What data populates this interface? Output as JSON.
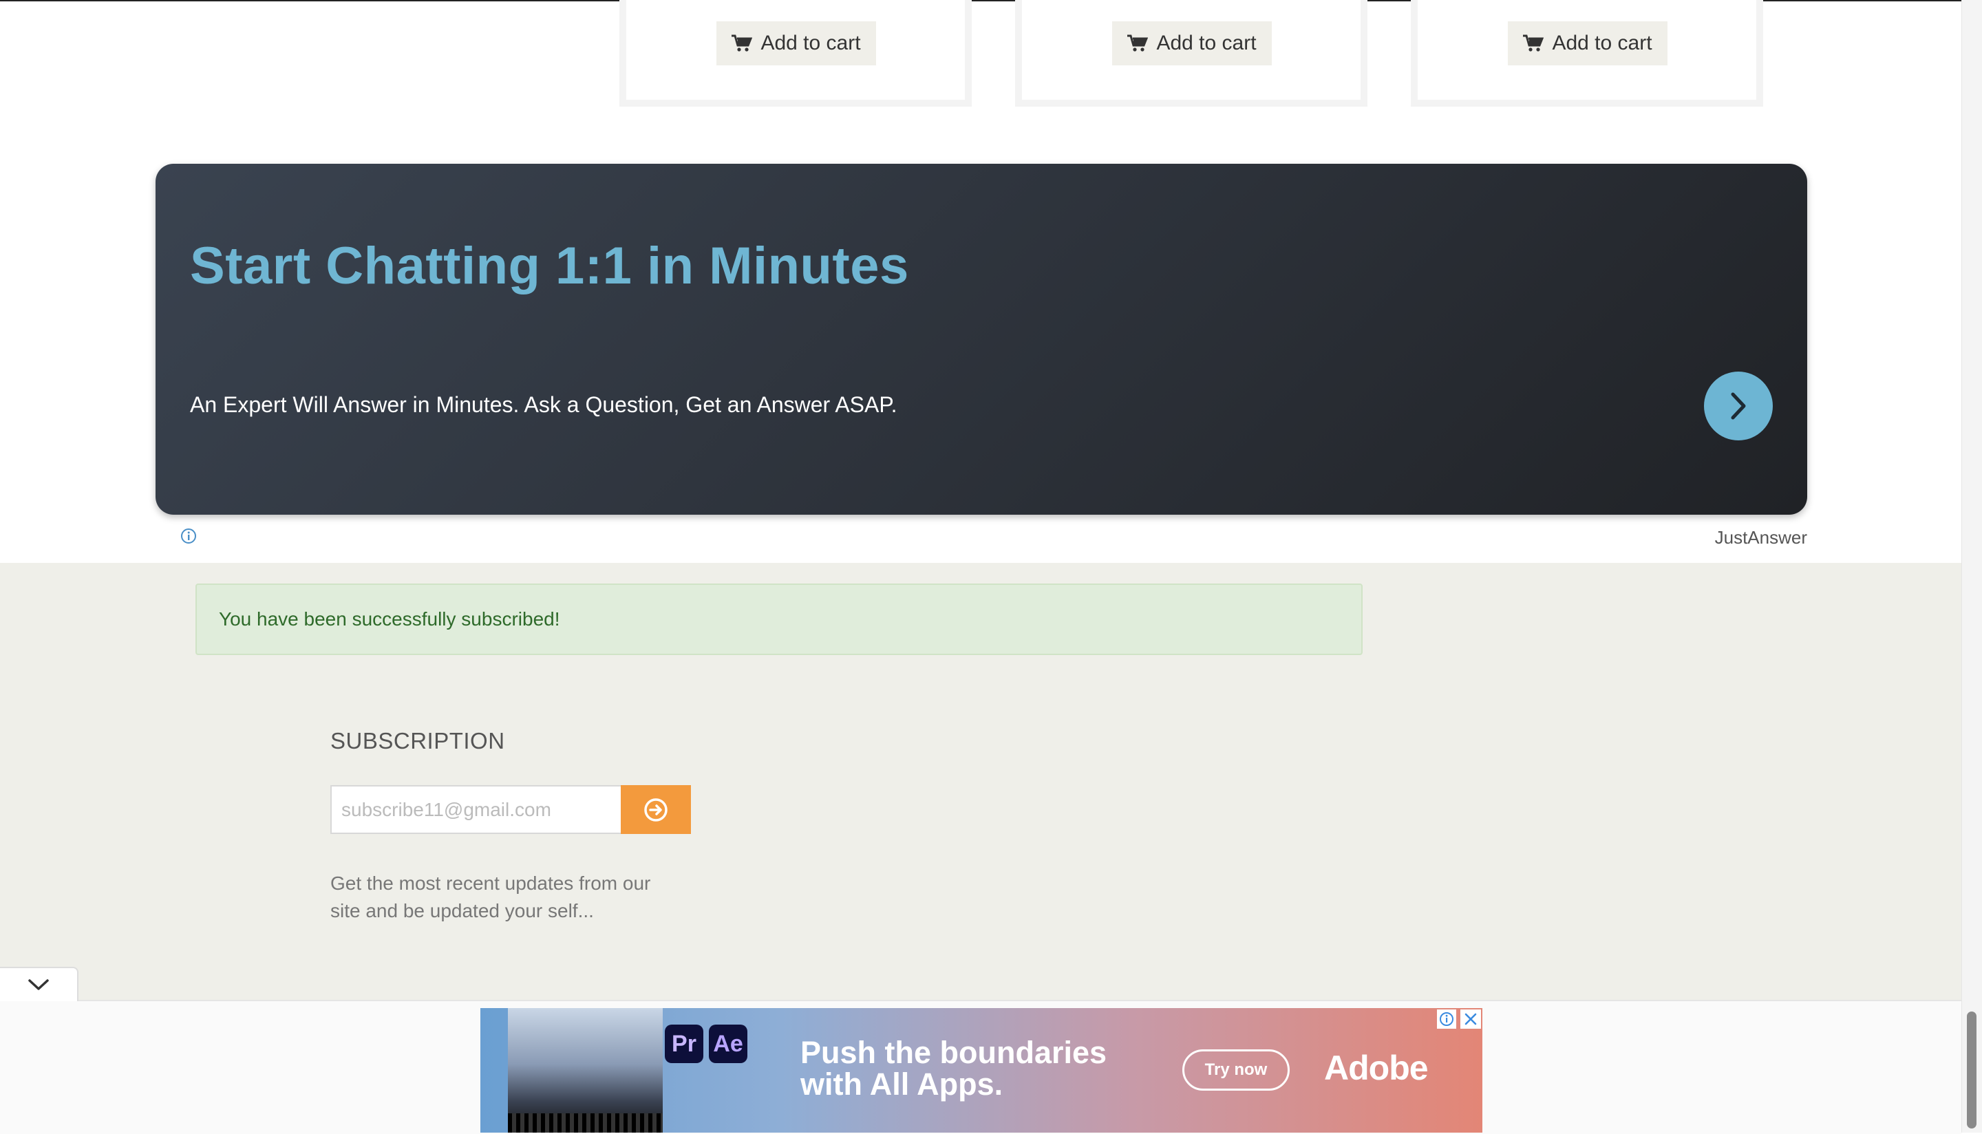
{
  "products": {
    "add_to_cart_label": "Add to cart",
    "cards": [
      {
        "add_label": "Add to cart"
      },
      {
        "add_label": "Add to cart"
      },
      {
        "add_label": "Add to cart"
      }
    ]
  },
  "ad_banner": {
    "title": "Start Chatting 1:1 in Minutes",
    "subtitle": "An Expert Will Answer in Minutes. Ask a Question, Get an Answer ASAP.",
    "brand": "JustAnswer",
    "title_color": "#6fb6d3",
    "arrow_color": "#6db5d3"
  },
  "alert": {
    "message": "You have been successfully subscribed!"
  },
  "subscription": {
    "heading": "SUBSCRIPTION",
    "email_placeholder": "subscribe11@gmail.com",
    "email_value": "",
    "description": "Get the most recent updates from our site and be updated your self...",
    "button_color": "#f39a3d"
  },
  "bottom_ad": {
    "headline": "Push the boundaries with All Apps.",
    "cta_label": "Try now",
    "brand": "Adobe",
    "app_tiles": [
      "Pr",
      "Ae"
    ]
  },
  "icons": {
    "cart": "cart-icon",
    "next": "chevron-right-icon",
    "info": "info-icon",
    "submit": "arrow-circle-right-icon",
    "collapse": "chevron-down-icon",
    "close": "close-icon"
  }
}
